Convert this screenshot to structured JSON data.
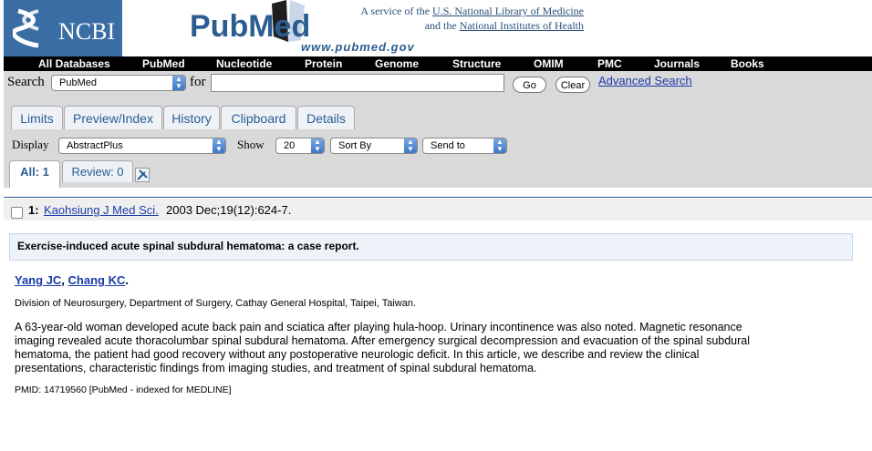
{
  "header": {
    "ncbi_logo_text": "NCBI",
    "pubmed_logo_text": "PubMed",
    "pubmed_url_text": "www.pubmed.gov",
    "service_line1_prefix": "A service of the ",
    "service_line1_link": "U.S. National Library of Medicine",
    "service_line2_prefix": "and the ",
    "service_line2_link": "National Institutes of Health"
  },
  "navbar": {
    "items": [
      "All Databases",
      "PubMed",
      "Nucleotide",
      "Protein",
      "Genome",
      "Structure",
      "OMIM",
      "PMC",
      "Journals",
      "Books"
    ]
  },
  "search": {
    "label": "Search",
    "database_value": "PubMed",
    "for_label": "for",
    "query_value": "",
    "go_label": "Go",
    "clear_label": "Clear",
    "advanced_label": "Advanced Search"
  },
  "tabs": [
    "Limits",
    "Preview/Index",
    "History",
    "Clipboard",
    "Details"
  ],
  "display": {
    "label": "Display",
    "format_value": "AbstractPlus",
    "show_label": "Show",
    "show_value": "20",
    "sort_value": "Sort By",
    "send_value": "Send to"
  },
  "subtabs": {
    "all": "All: 1",
    "review": "Review: 0"
  },
  "result": {
    "number": "1:",
    "journal": "Kaohsiung J Med Sci.",
    "citation": "2003 Dec;19(12):624-7.",
    "title": "Exercise-induced acute spinal subdural hematoma: a case report.",
    "author1": "Yang JC",
    "author_sep": ", ",
    "author2": "Chang KC",
    "author_end": ".",
    "affiliation": "Division of Neurosurgery, Department of Surgery, Cathay General Hospital, Taipei, Taiwan.",
    "abstract_lines": [
      "A 63-year-old woman developed acute back pain and sciatica after playing hula-hoop. Urinary incontinence was also noted. Magnetic resonance",
      "imaging revealed acute thoracolumbar spinal subdural hematoma. After emergency surgical decompression and evacuation of the spinal subdural",
      "hematoma, the patient had good recovery without any postoperative neurologic deficit. In this article, we describe and review the clinical",
      "presentations, characteristic findings from imaging studies, and treatment of spinal subdural hematoma."
    ],
    "pmid_line": "PMID: 14719560 [PubMed - indexed for MEDLINE]"
  }
}
